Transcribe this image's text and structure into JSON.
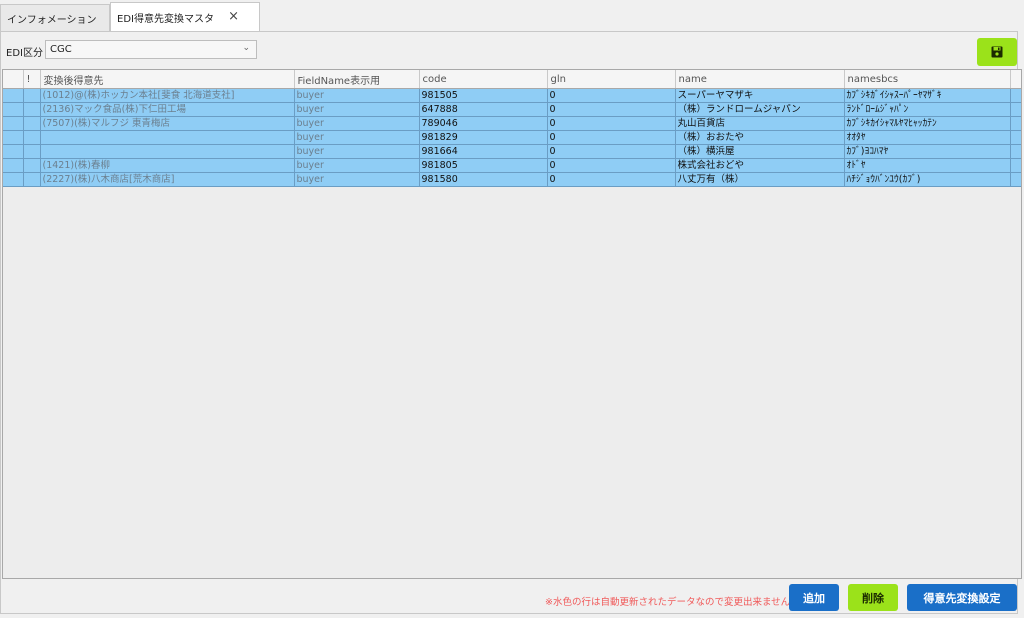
{
  "tabs": [
    {
      "label": "インフォメーション"
    },
    {
      "label": "EDI得意先変換マスタ",
      "close": "×"
    }
  ],
  "filter": {
    "label": "EDI区分",
    "value": "CGC"
  },
  "columns": [
    "",
    "!",
    "変換後得意先",
    "FieldName表示用",
    "code",
    "gln",
    "name",
    "namesbcs",
    ""
  ],
  "rows": [
    {
      "customer": "(1012)@(株)ホッカン本社[斐食 北海道支社]",
      "field": "buyer",
      "code": "981505",
      "gln": "0",
      "name": "スーパーヤマザキ",
      "namesbcs": "ｶﾌﾞｼｷｶﾞｲｼｬｽｰﾊﾟｰﾔﾏｻﾞｷ"
    },
    {
      "customer": "(2136)マック食品(株)下仁田工場",
      "field": "buyer",
      "code": "647888",
      "gln": "0",
      "name": "（株）ランドロームジャパン",
      "namesbcs": "ﾗﾝﾄﾞﾛｰﾑｼﾞｬﾊﾟﾝ"
    },
    {
      "customer": "(7507)(株)マルフジ 東青梅店",
      "field": "buyer",
      "code": "789046",
      "gln": "0",
      "name": "丸山百貨店",
      "namesbcs": "ｶﾌﾞｼｷｶｲｼｬﾏﾙﾔﾏﾋｬｯｶﾃﾝ"
    },
    {
      "customer": "",
      "field": "buyer",
      "code": "981829",
      "gln": "0",
      "name": "（株）おおたや",
      "namesbcs": "ｵｵﾀﾔ"
    },
    {
      "customer": "",
      "field": "buyer",
      "code": "981664",
      "gln": "0",
      "name": "（株）横浜屋",
      "namesbcs": "ｶﾌﾞ)ﾖｺﾊﾏﾔ"
    },
    {
      "customer": "(1421)(株)春柳",
      "field": "buyer",
      "code": "981805",
      "gln": "0",
      "name": "株式会社おどや",
      "namesbcs": "ｵﾄﾞﾔ"
    },
    {
      "customer": "(2227)(株)八木商店[荒木商店]",
      "field": "buyer",
      "code": "981580",
      "gln": "0",
      "name": "八丈万有（株）",
      "namesbcs": "ﾊﾁｼﾞｮｳﾊﾞﾝﾕｳ(ｶﾌﾞ)"
    }
  ],
  "note": "※水色の行は自動更新されたデータなので変更出来ません。",
  "buttons": {
    "add": "追加",
    "delete": "削除",
    "convert": "得意先変換設定"
  },
  "colors": {
    "row_bg": "#8fcdf5",
    "primary": "#1a6fc8",
    "accent_green": "#9be21a",
    "note_red": "#f05a5a"
  },
  "icons": {
    "save": "save-icon"
  }
}
